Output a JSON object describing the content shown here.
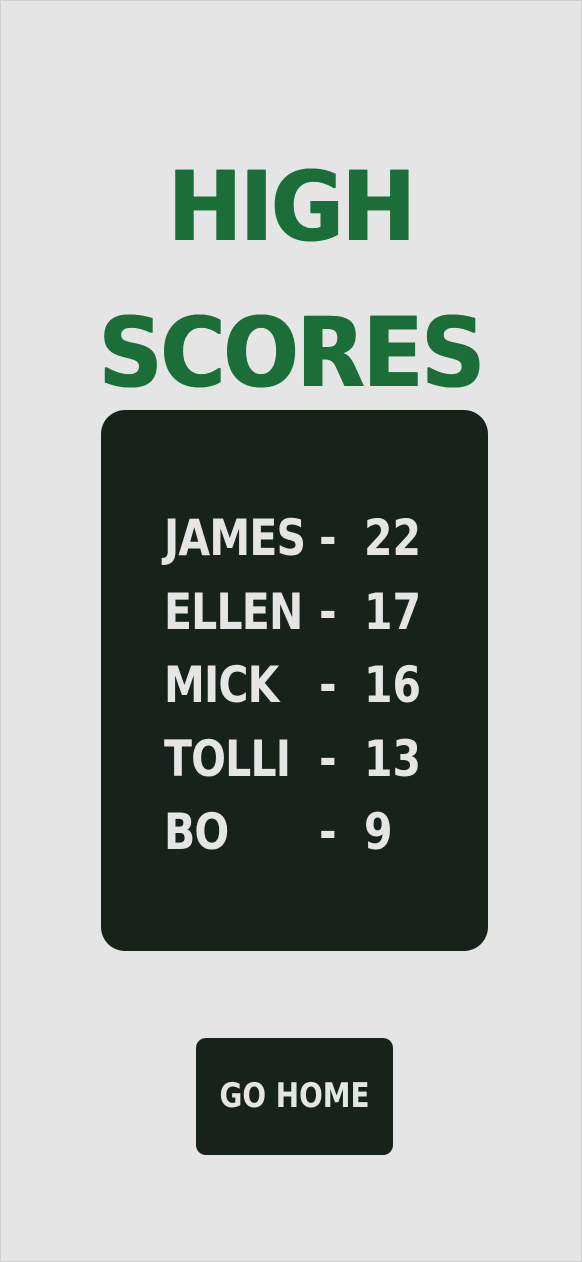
{
  "title": {
    "line1": "HIGH",
    "line2": "SCORES"
  },
  "scores": [
    {
      "name": "JAMES",
      "separator": "-",
      "score": "22"
    },
    {
      "name": "ELLEN",
      "separator": "-",
      "score": "17"
    },
    {
      "name": "MICK",
      "separator": "-",
      "score": "16"
    },
    {
      "name": "TOLLI",
      "separator": "-",
      "score": "13"
    },
    {
      "name": "BO",
      "separator": "-",
      "score": "9"
    }
  ],
  "home_button": {
    "label": "GO HOME"
  },
  "colors": {
    "background": "#e5e5e5",
    "title": "#1b6e38",
    "panel": "#17231a",
    "panel_text": "#e5e5e5"
  }
}
